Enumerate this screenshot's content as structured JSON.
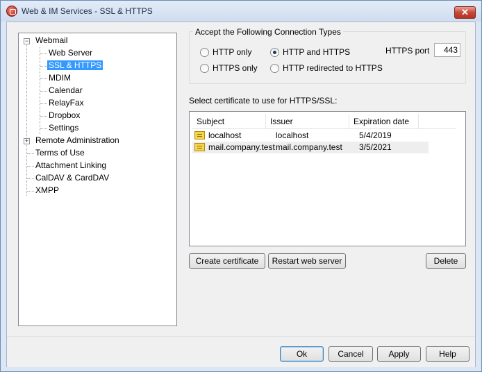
{
  "window": {
    "title": "Web & IM Services - SSL & HTTPS",
    "close_glyph": "✕",
    "icon": "app-logo-icon"
  },
  "tree": {
    "items": [
      {
        "label": "Webmail",
        "expander": "−"
      },
      {
        "label": "Web Server"
      },
      {
        "label": "SSL & HTTPS",
        "selected": true
      },
      {
        "label": "MDIM"
      },
      {
        "label": "Calendar"
      },
      {
        "label": "RelayFax"
      },
      {
        "label": "Dropbox"
      },
      {
        "label": "Settings"
      },
      {
        "label": "Remote Administration",
        "expander": "+"
      },
      {
        "label": "Terms of Use"
      },
      {
        "label": "Attachment Linking"
      },
      {
        "label": "CalDAV & CardDAV"
      },
      {
        "label": "XMPP"
      }
    ]
  },
  "connection": {
    "group_title": "Accept the Following Connection Types",
    "options": [
      {
        "label": "HTTP only",
        "checked": false
      },
      {
        "label": "HTTP and HTTPS",
        "checked": true
      },
      {
        "label": "HTTPS only",
        "checked": false
      },
      {
        "label": "HTTP redirected to HTTPS",
        "checked": false
      }
    ],
    "port_label": "HTTPS port",
    "port_value": "443"
  },
  "certificates": {
    "label": "Select certificate to use for HTTPS/SSL:",
    "columns": [
      "Subject",
      "Issuer",
      "Expiration date"
    ],
    "rows": [
      {
        "subject": "localhost",
        "issuer": "localhost",
        "expires": "5/4/2019"
      },
      {
        "subject": "mail.company.test",
        "issuer": "mail.company.test",
        "expires": "3/5/2021"
      }
    ],
    "buttons": {
      "create": "Create certificate",
      "restart": "Restart web server",
      "delete": "Delete"
    }
  },
  "dialog_buttons": {
    "ok": "Ok",
    "cancel": "Cancel",
    "apply": "Apply",
    "help": "Help"
  }
}
